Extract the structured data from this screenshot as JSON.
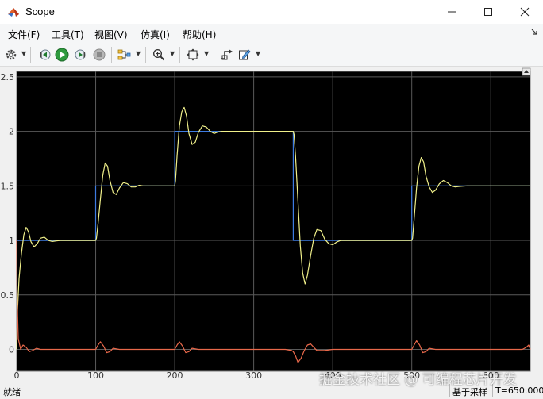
{
  "window": {
    "title": "Scope"
  },
  "menu": [
    {
      "label": "文件(F)"
    },
    {
      "label": "工具(T)"
    },
    {
      "label": "视图(V)"
    },
    {
      "label": "仿真(I)"
    },
    {
      "label": "帮助(H)"
    }
  ],
  "status": {
    "left": "就绪",
    "sample": "基于采样",
    "time": "T=650.000"
  },
  "watermark": "掘金技术社区 @ 可编程芯片开发",
  "colors": {
    "reference": "#3d7be0",
    "response": "#f0f08a",
    "error": "#e8684a",
    "plot_bg": "#000000",
    "grid": "#5a5a5a"
  },
  "chart_data": {
    "type": "line",
    "xlim": [
      0,
      650
    ],
    "ylim": [
      -0.2,
      2.55
    ],
    "xticks": [
      "0",
      "100",
      "200",
      "300",
      "400",
      "500",
      "600"
    ],
    "yticks": [
      "0",
      "0.5",
      "1",
      "1.5",
      "2",
      "2.5"
    ],
    "grid": true,
    "series": [
      {
        "color": "#3d7be0",
        "kind": "step",
        "x": [
          0,
          100,
          100,
          200,
          200,
          350,
          350,
          500,
          500,
          650
        ],
        "y": [
          1,
          1,
          1.5,
          1.5,
          2,
          2,
          1,
          1,
          1.5,
          1.5
        ]
      },
      {
        "color": "#f0f08a",
        "kind": "response",
        "x": [
          0,
          1,
          3,
          6,
          9,
          12,
          15,
          18,
          22,
          26,
          30,
          35,
          40,
          45,
          50,
          55,
          60,
          70,
          80,
          90,
          100,
          101,
          103,
          106,
          109,
          112,
          115,
          118,
          122,
          126,
          130,
          135,
          140,
          145,
          150,
          155,
          160,
          170,
          180,
          190,
          200,
          201,
          203,
          206,
          209,
          212,
          215,
          218,
          222,
          226,
          230,
          235,
          240,
          245,
          250,
          255,
          260,
          270,
          280,
          290,
          300,
          320,
          340,
          350,
          351,
          353,
          356,
          359,
          362,
          365,
          368,
          372,
          376,
          380,
          385,
          390,
          395,
          400,
          405,
          410,
          420,
          430,
          440,
          450,
          470,
          490,
          500,
          501,
          503,
          506,
          509,
          512,
          515,
          518,
          522,
          526,
          530,
          535,
          540,
          545,
          550,
          555,
          560,
          570,
          580,
          590,
          600,
          620,
          640,
          650
        ],
        "y": [
          0,
          0.35,
          0.65,
          0.88,
          1.05,
          1.12,
          1.08,
          0.99,
          0.94,
          0.97,
          1.02,
          1.03,
          1.0,
          0.99,
          0.995,
          1.0,
          1.0,
          1.0,
          1.0,
          1.0,
          1.0,
          1.02,
          1.15,
          1.38,
          1.6,
          1.71,
          1.68,
          1.55,
          1.44,
          1.42,
          1.48,
          1.53,
          1.52,
          1.49,
          1.49,
          1.505,
          1.5,
          1.5,
          1.5,
          1.5,
          1.5,
          1.55,
          1.78,
          2.05,
          2.18,
          2.22,
          2.14,
          1.98,
          1.88,
          1.9,
          1.99,
          2.05,
          2.04,
          2.0,
          1.98,
          1.995,
          2.0,
          2.0,
          2.0,
          2.0,
          2.0,
          2.0,
          2.0,
          2.0,
          1.97,
          1.76,
          1.35,
          0.95,
          0.7,
          0.6,
          0.68,
          0.86,
          1.02,
          1.1,
          1.09,
          1.01,
          0.97,
          0.96,
          0.985,
          1.0,
          1.0,
          1.0,
          1.0,
          1.0,
          1.0,
          1.0,
          1.0,
          1.02,
          1.2,
          1.48,
          1.68,
          1.76,
          1.72,
          1.59,
          1.49,
          1.44,
          1.46,
          1.52,
          1.55,
          1.53,
          1.5,
          1.49,
          1.495,
          1.5,
          1.5,
          1.5,
          1.5,
          1.5,
          1.5,
          1.5
        ]
      },
      {
        "color": "#e8684a",
        "kind": "error",
        "x": [
          0,
          0.5,
          2,
          5,
          8,
          12,
          16,
          20,
          25,
          30,
          40,
          60,
          80,
          95,
          100,
          103,
          106,
          110,
          114,
          118,
          122,
          130,
          140,
          160,
          180,
          195,
          200,
          203,
          206,
          210,
          214,
          218,
          222,
          230,
          240,
          260,
          300,
          340,
          348,
          350,
          353,
          356,
          360,
          364,
          368,
          372,
          376,
          380,
          390,
          400,
          420,
          460,
          495,
          500,
          503,
          506,
          510,
          514,
          518,
          522,
          530,
          540,
          560,
          600,
          640,
          645,
          648,
          650
        ],
        "y": [
          1.0,
          0.5,
          0.1,
          0.0,
          0.04,
          0.02,
          -0.02,
          -0.01,
          0.01,
          0.0,
          0.0,
          0.0,
          0.0,
          0.0,
          0.0,
          0.04,
          0.07,
          0.03,
          -0.03,
          -0.02,
          0.01,
          0.0,
          0.0,
          0.0,
          0.0,
          0.0,
          0.0,
          0.04,
          0.07,
          0.03,
          -0.03,
          -0.02,
          0.01,
          0.0,
          0.0,
          0.0,
          0.0,
          0.0,
          -0.01,
          -0.02,
          -0.06,
          -0.12,
          -0.08,
          -0.01,
          0.04,
          0.05,
          0.02,
          -0.01,
          -0.01,
          0.0,
          0.0,
          0.0,
          0.0,
          0.0,
          0.04,
          0.08,
          0.04,
          -0.03,
          -0.02,
          0.01,
          0.0,
          0.0,
          0.0,
          0.0,
          0.0,
          0.02,
          0.04,
          0.0
        ]
      }
    ]
  }
}
